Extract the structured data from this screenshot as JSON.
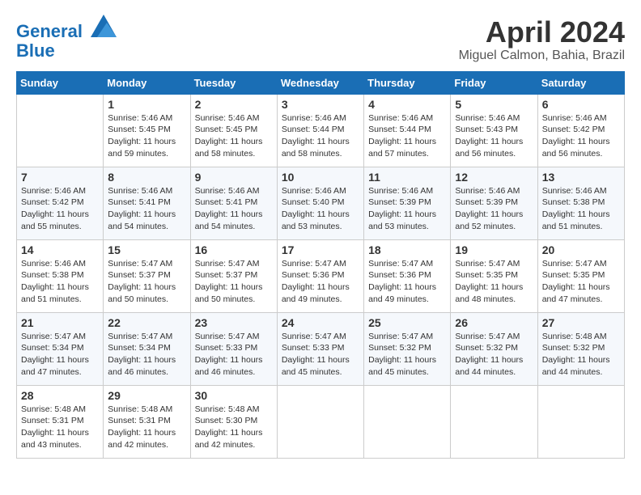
{
  "logo": {
    "line1": "General",
    "line2": "Blue"
  },
  "title": "April 2024",
  "subtitle": "Miguel Calmon, Bahia, Brazil",
  "weekdays": [
    "Sunday",
    "Monday",
    "Tuesday",
    "Wednesday",
    "Thursday",
    "Friday",
    "Saturday"
  ],
  "weeks": [
    [
      {
        "day": "",
        "info": ""
      },
      {
        "day": "1",
        "info": "Sunrise: 5:46 AM\nSunset: 5:45 PM\nDaylight: 11 hours\nand 59 minutes."
      },
      {
        "day": "2",
        "info": "Sunrise: 5:46 AM\nSunset: 5:45 PM\nDaylight: 11 hours\nand 58 minutes."
      },
      {
        "day": "3",
        "info": "Sunrise: 5:46 AM\nSunset: 5:44 PM\nDaylight: 11 hours\nand 58 minutes."
      },
      {
        "day": "4",
        "info": "Sunrise: 5:46 AM\nSunset: 5:44 PM\nDaylight: 11 hours\nand 57 minutes."
      },
      {
        "day": "5",
        "info": "Sunrise: 5:46 AM\nSunset: 5:43 PM\nDaylight: 11 hours\nand 56 minutes."
      },
      {
        "day": "6",
        "info": "Sunrise: 5:46 AM\nSunset: 5:42 PM\nDaylight: 11 hours\nand 56 minutes."
      }
    ],
    [
      {
        "day": "7",
        "info": "Sunrise: 5:46 AM\nSunset: 5:42 PM\nDaylight: 11 hours\nand 55 minutes."
      },
      {
        "day": "8",
        "info": "Sunrise: 5:46 AM\nSunset: 5:41 PM\nDaylight: 11 hours\nand 54 minutes."
      },
      {
        "day": "9",
        "info": "Sunrise: 5:46 AM\nSunset: 5:41 PM\nDaylight: 11 hours\nand 54 minutes."
      },
      {
        "day": "10",
        "info": "Sunrise: 5:46 AM\nSunset: 5:40 PM\nDaylight: 11 hours\nand 53 minutes."
      },
      {
        "day": "11",
        "info": "Sunrise: 5:46 AM\nSunset: 5:39 PM\nDaylight: 11 hours\nand 53 minutes."
      },
      {
        "day": "12",
        "info": "Sunrise: 5:46 AM\nSunset: 5:39 PM\nDaylight: 11 hours\nand 52 minutes."
      },
      {
        "day": "13",
        "info": "Sunrise: 5:46 AM\nSunset: 5:38 PM\nDaylight: 11 hours\nand 51 minutes."
      }
    ],
    [
      {
        "day": "14",
        "info": "Sunrise: 5:46 AM\nSunset: 5:38 PM\nDaylight: 11 hours\nand 51 minutes."
      },
      {
        "day": "15",
        "info": "Sunrise: 5:47 AM\nSunset: 5:37 PM\nDaylight: 11 hours\nand 50 minutes."
      },
      {
        "day": "16",
        "info": "Sunrise: 5:47 AM\nSunset: 5:37 PM\nDaylight: 11 hours\nand 50 minutes."
      },
      {
        "day": "17",
        "info": "Sunrise: 5:47 AM\nSunset: 5:36 PM\nDaylight: 11 hours\nand 49 minutes."
      },
      {
        "day": "18",
        "info": "Sunrise: 5:47 AM\nSunset: 5:36 PM\nDaylight: 11 hours\nand 49 minutes."
      },
      {
        "day": "19",
        "info": "Sunrise: 5:47 AM\nSunset: 5:35 PM\nDaylight: 11 hours\nand 48 minutes."
      },
      {
        "day": "20",
        "info": "Sunrise: 5:47 AM\nSunset: 5:35 PM\nDaylight: 11 hours\nand 47 minutes."
      }
    ],
    [
      {
        "day": "21",
        "info": "Sunrise: 5:47 AM\nSunset: 5:34 PM\nDaylight: 11 hours\nand 47 minutes."
      },
      {
        "day": "22",
        "info": "Sunrise: 5:47 AM\nSunset: 5:34 PM\nDaylight: 11 hours\nand 46 minutes."
      },
      {
        "day": "23",
        "info": "Sunrise: 5:47 AM\nSunset: 5:33 PM\nDaylight: 11 hours\nand 46 minutes."
      },
      {
        "day": "24",
        "info": "Sunrise: 5:47 AM\nSunset: 5:33 PM\nDaylight: 11 hours\nand 45 minutes."
      },
      {
        "day": "25",
        "info": "Sunrise: 5:47 AM\nSunset: 5:32 PM\nDaylight: 11 hours\nand 45 minutes."
      },
      {
        "day": "26",
        "info": "Sunrise: 5:47 AM\nSunset: 5:32 PM\nDaylight: 11 hours\nand 44 minutes."
      },
      {
        "day": "27",
        "info": "Sunrise: 5:48 AM\nSunset: 5:32 PM\nDaylight: 11 hours\nand 44 minutes."
      }
    ],
    [
      {
        "day": "28",
        "info": "Sunrise: 5:48 AM\nSunset: 5:31 PM\nDaylight: 11 hours\nand 43 minutes."
      },
      {
        "day": "29",
        "info": "Sunrise: 5:48 AM\nSunset: 5:31 PM\nDaylight: 11 hours\nand 42 minutes."
      },
      {
        "day": "30",
        "info": "Sunrise: 5:48 AM\nSunset: 5:30 PM\nDaylight: 11 hours\nand 42 minutes."
      },
      {
        "day": "",
        "info": ""
      },
      {
        "day": "",
        "info": ""
      },
      {
        "day": "",
        "info": ""
      },
      {
        "day": "",
        "info": ""
      }
    ]
  ]
}
